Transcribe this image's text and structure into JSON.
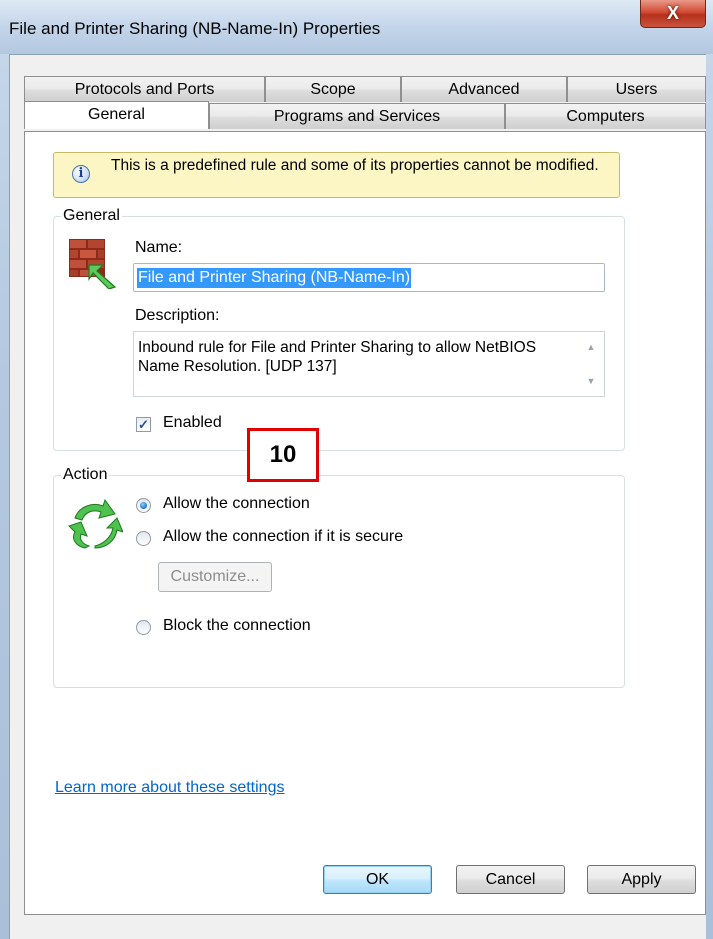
{
  "window": {
    "title": "File and Printer Sharing (NB-Name-In) Properties",
    "close_glyph": "X"
  },
  "tabs": {
    "row_back": [
      "Protocols and Ports",
      "Scope",
      "Advanced",
      "Users"
    ],
    "row_front": [
      "General",
      "Programs and Services",
      "Computers"
    ],
    "active": "General"
  },
  "info": {
    "text": "This is a predefined rule and some of its properties cannot be modified."
  },
  "general_group": {
    "label": "General",
    "name_label": "Name:",
    "name_value": "File and Printer Sharing (NB-Name-In)",
    "description_label": "Description:",
    "description_value": "Inbound rule for File and Printer Sharing to allow NetBIOS Name Resolution. [UDP 137]",
    "enabled_label": "Enabled",
    "enabled_checked": true
  },
  "annotation": {
    "number": "10",
    "color": "#e00000"
  },
  "action_group": {
    "label": "Action",
    "options": [
      {
        "label": "Allow the connection",
        "checked": true
      },
      {
        "label": "Allow the connection if it is secure",
        "checked": false
      },
      {
        "label": "Block the connection",
        "checked": false
      }
    ],
    "customize_label": "Customize..."
  },
  "footer": {
    "learn_more": "Learn more about these settings",
    "ok_label": "OK",
    "cancel_label": "Cancel",
    "apply_label": "Apply"
  },
  "icons": {
    "rule_icon": "firewall-brick-arrow-icon",
    "action_icon": "green-refresh-arrows-icon",
    "info_icon": "info-icon"
  }
}
